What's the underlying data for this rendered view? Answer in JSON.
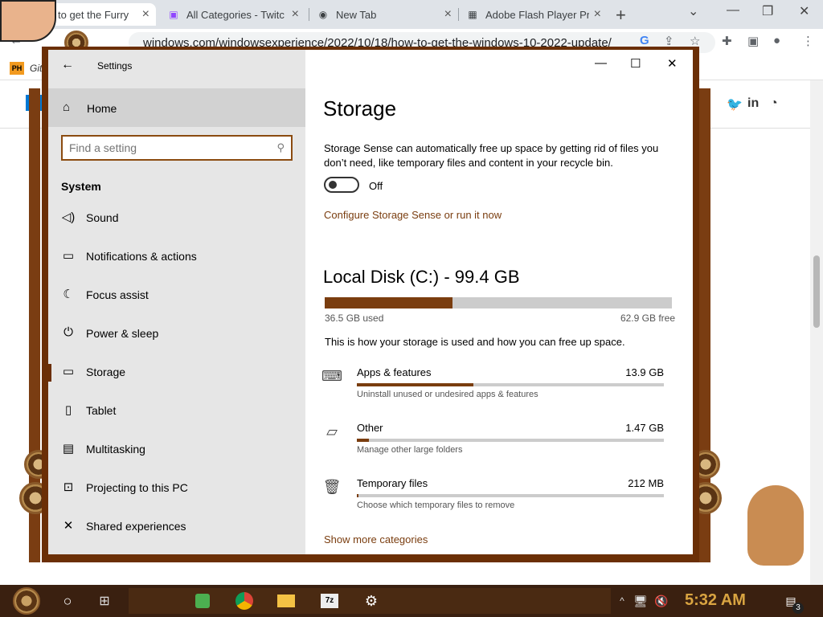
{
  "browser": {
    "tabs": [
      {
        "title": "to get the Furry",
        "active": true
      },
      {
        "title": "All Categories - Twitc",
        "active": false
      },
      {
        "title": "New Tab",
        "active": false
      },
      {
        "title": "Adobe Flash Player Pr",
        "active": false
      }
    ],
    "new_tab_symbol": "+",
    "url_prefix": "windows.com",
    "url_rest": "/windowsexperience/2022/10/18/how-to-get-the-windows-10-2022-update/",
    "bookmark_badge": "PH",
    "bookmark_text": "Git"
  },
  "settings": {
    "app_title": "Settings",
    "home_label": "Home",
    "search_placeholder": "Find a setting",
    "section": "System",
    "nav": [
      {
        "label": "Sound",
        "icon": "speaker-icon"
      },
      {
        "label": "Notifications & actions",
        "icon": "notifications-icon"
      },
      {
        "label": "Focus assist",
        "icon": "moon-icon"
      },
      {
        "label": "Power & sleep",
        "icon": "power-icon"
      },
      {
        "label": "Storage",
        "icon": "storage-icon",
        "selected": true
      },
      {
        "label": "Tablet",
        "icon": "tablet-icon"
      },
      {
        "label": "Multitasking",
        "icon": "multitasking-icon"
      },
      {
        "label": "Projecting to this PC",
        "icon": "projecting-icon"
      },
      {
        "label": "Shared experiences",
        "icon": "shared-experiences-icon"
      }
    ],
    "page_title": "Storage",
    "description": "Storage Sense can automatically free up space by getting rid of files you don’t need, like temporary files and content in your recycle bin.",
    "toggle_state": "Off",
    "configure_link": "Configure Storage Sense or run it now",
    "disk_title": "Local Disk (C:) - 99.4 GB",
    "used": "36.5 GB used",
    "free": "62.9 GB free",
    "used_fraction": 0.367,
    "how_text": "This is how your storage is used and how you can free up space.",
    "categories": [
      {
        "name": "Apps & features",
        "size": "13.9 GB",
        "sub": "Uninstall unused or undesired apps & features",
        "fraction": 0.38
      },
      {
        "name": "Other",
        "size": "1.47 GB",
        "sub": "Manage other large folders",
        "fraction": 0.04
      },
      {
        "name": "Temporary files",
        "size": "212 MB",
        "sub": "Choose which temporary files to remove",
        "fraction": 0.005
      }
    ],
    "show_more": "Show more categories"
  },
  "taskbar": {
    "clock": "5:32 AM",
    "notification_count": "3"
  },
  "colors": {
    "accent": "#7a3d0f",
    "frame": "#6b2f06",
    "sidebar_bg": "#e6e6e6"
  }
}
